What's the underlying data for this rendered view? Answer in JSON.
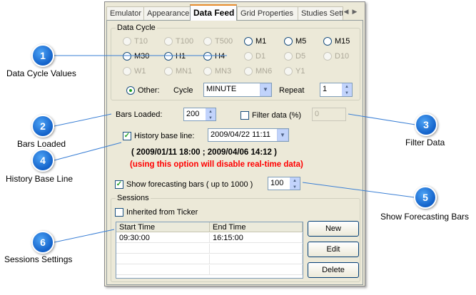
{
  "tabs": [
    "Emulator",
    "Appearance",
    "Data Feed",
    "Grid Properties",
    "Studies Sett"
  ],
  "data_cycle": {
    "title": "Data Cycle",
    "rows": [
      [
        {
          "label": "T10",
          "state": "disabled"
        },
        {
          "label": "T100",
          "state": "disabled"
        },
        {
          "label": "T500",
          "state": "disabled"
        },
        {
          "label": "M1",
          "state": "enabled"
        },
        {
          "label": "M5",
          "state": "enabled"
        },
        {
          "label": "M15",
          "state": "enabled"
        }
      ],
      [
        {
          "label": "M30",
          "state": "enabled"
        },
        {
          "label": "H1",
          "state": "enabled"
        },
        {
          "label": "H4",
          "state": "enabled"
        },
        {
          "label": "D1",
          "state": "disabled"
        },
        {
          "label": "D5",
          "state": "disabled"
        },
        {
          "label": "D10",
          "state": "disabled"
        }
      ],
      [
        {
          "label": "W1",
          "state": "disabled"
        },
        {
          "label": "MN1",
          "state": "disabled"
        },
        {
          "label": "MN3",
          "state": "disabled"
        },
        {
          "label": "MN6",
          "state": "disabled"
        },
        {
          "label": "Y1",
          "state": "disabled"
        }
      ]
    ],
    "other_label": "Other:",
    "cycle_label": "Cycle",
    "cycle_value": "MINUTE",
    "repeat_label": "Repeat",
    "repeat_value": "1"
  },
  "bars_loaded": {
    "label": "Bars Loaded:",
    "value": "200"
  },
  "filter_data": {
    "label": "Filter data (%)",
    "value": "0"
  },
  "history": {
    "label": "History base line:",
    "value": "2009/04/22 11:11",
    "range": "( 2009/01/11 18:00 ; 2009/04/06 14:12 )",
    "warning": "(using this option will disable real-time data)"
  },
  "forecast": {
    "label": "Show forecasting bars ( up to 1000 )",
    "value": "100"
  },
  "sessions": {
    "title": "Sessions",
    "inherited_label": "Inherited from Ticker",
    "columns": [
      "Start Time",
      "End Time"
    ],
    "rows": [
      [
        "09:30:00",
        "16:15:00"
      ],
      [
        "",
        ""
      ],
      [
        "",
        ""
      ],
      [
        "",
        ""
      ]
    ],
    "buttons": {
      "new": "New",
      "edit": "Edit",
      "delete": "Delete"
    }
  },
  "callouts": [
    {
      "num": "1",
      "caption": "Data Cycle Values"
    },
    {
      "num": "2",
      "caption": "Bars Loaded"
    },
    {
      "num": "3",
      "caption": "Filter Data"
    },
    {
      "num": "4",
      "caption": "History Base Line"
    },
    {
      "num": "5",
      "caption": "Show Forecasting Bars"
    },
    {
      "num": "6",
      "caption": "Sessions Settings"
    }
  ],
  "colors": {
    "accent_tab": "#e68b2c",
    "radio_checked": "#21a121",
    "warning": "#ff0000",
    "callout": "#1261c9"
  },
  "icons": {
    "tab_scroll": "chevron-left-right",
    "spin": "up-down-arrows",
    "dropdown": "chevron-down"
  }
}
